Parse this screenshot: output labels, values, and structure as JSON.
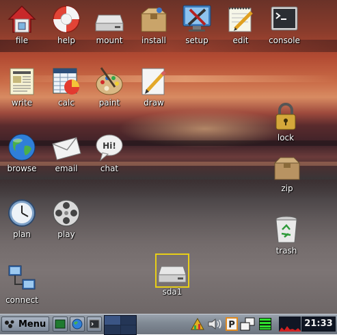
{
  "desktop": {
    "icons": [
      {
        "label": "file",
        "icon": "home-folder-icon"
      },
      {
        "label": "help",
        "icon": "lifebuoy-icon"
      },
      {
        "label": "mount",
        "icon": "drive-icon"
      },
      {
        "label": "install",
        "icon": "package-box-icon"
      },
      {
        "label": "setup",
        "icon": "tools-icon"
      },
      {
        "label": "edit",
        "icon": "notepad-icon"
      },
      {
        "label": "console",
        "icon": "terminal-icon"
      },
      {
        "label": "write",
        "icon": "document-icon"
      },
      {
        "label": "calc",
        "icon": "spreadsheet-icon"
      },
      {
        "label": "paint",
        "icon": "palette-icon"
      },
      {
        "label": "draw",
        "icon": "pencil-paper-icon"
      },
      {
        "label": "lock",
        "icon": "padlock-icon"
      },
      {
        "label": "browse",
        "icon": "globe-icon"
      },
      {
        "label": "email",
        "icon": "envelope-icon"
      },
      {
        "label": "chat",
        "icon": "speech-bubble-icon"
      },
      {
        "label": "zip",
        "icon": "archive-box-icon"
      },
      {
        "label": "plan",
        "icon": "clock-icon"
      },
      {
        "label": "play",
        "icon": "film-reel-icon"
      },
      {
        "label": "trash",
        "icon": "trash-can-icon"
      },
      {
        "label": "sda1",
        "icon": "drive-icon"
      },
      {
        "label": "connect",
        "icon": "network-icon"
      }
    ],
    "chat_bubble_text": "Hi!",
    "selected_icon": "sda1"
  },
  "taskbar": {
    "menu_label": "Menu",
    "clock": "21:33",
    "pager_active": 1
  },
  "colors": {
    "selection": "#e8cf17",
    "taskbar": "#7f8893",
    "clock_bg": "#0f1522"
  }
}
